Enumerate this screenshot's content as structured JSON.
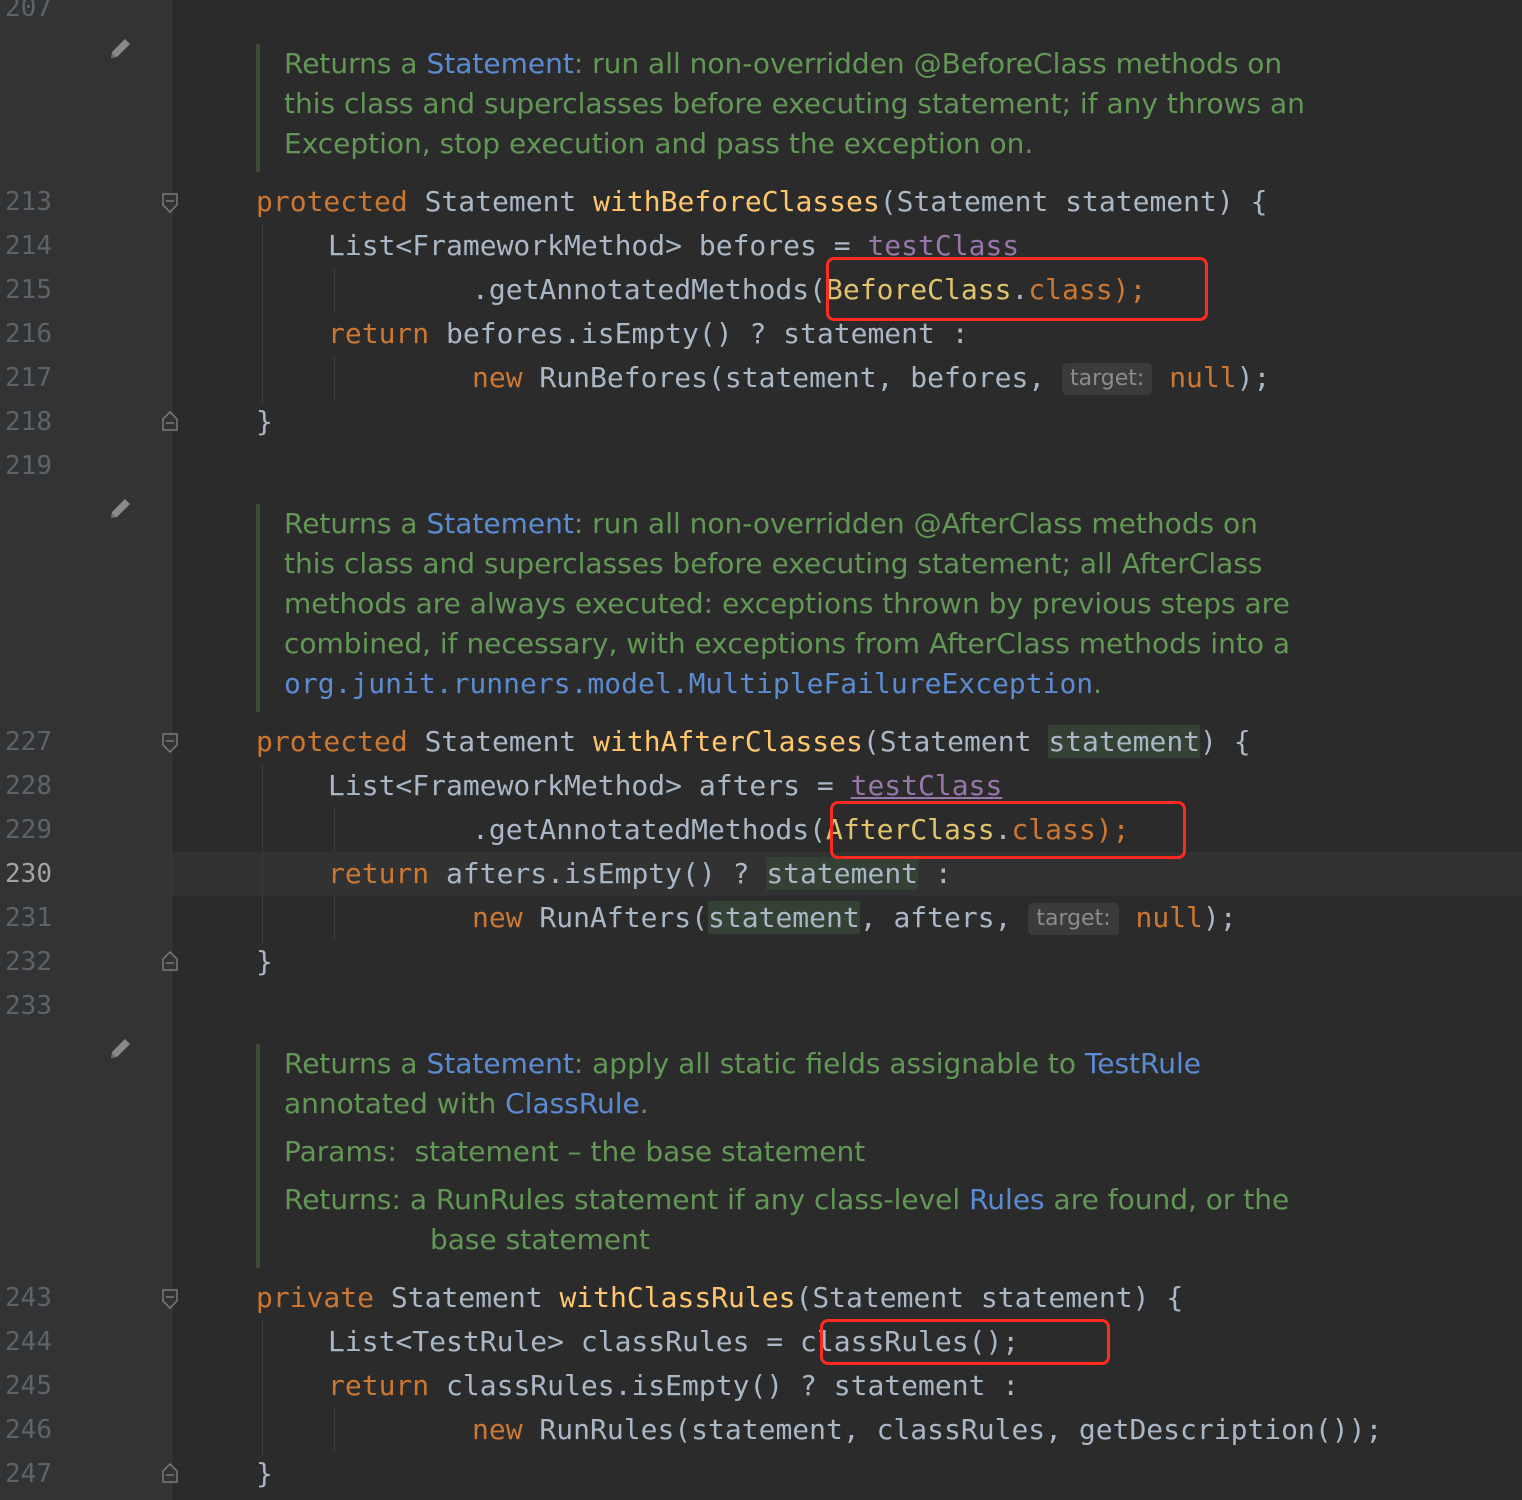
{
  "gutter": {
    "line_numbers": {
      "l207": "207",
      "l213": "213",
      "l214": "214",
      "l215": "215",
      "l216": "216",
      "l217": "217",
      "l218": "218",
      "l219": "219",
      "l227": "227",
      "l228": "228",
      "l229": "229",
      "l230": "230",
      "l231": "231",
      "l232": "232",
      "l233": "233",
      "l243": "243",
      "l244": "244",
      "l245": "245",
      "l246": "246",
      "l247": "247"
    },
    "current_line": "230"
  },
  "docs": {
    "before_classes": {
      "p1": "Returns a ",
      "link": "Statement",
      "p2": ": run all non-overridden @BeforeClass methods on",
      "line2": "this class and superclasses before executing statement; if any throws an",
      "line3": "Exception, stop execution and pass the exception on."
    },
    "after_classes": {
      "p1": "Returns a ",
      "link": "Statement",
      "p2": ": run all non-overridden @AfterClass methods on",
      "line2": "this class and superclasses before executing statement; all AfterClass",
      "line3": "methods are always executed: exceptions thrown by previous steps are",
      "line4": "combined, if necessary, with exceptions from AfterClass methods into a",
      "link2": "org.junit.runners.model.MultipleFailureException",
      "end": "."
    },
    "class_rules": {
      "p1": "Returns a ",
      "link": "Statement",
      "p2": ": apply all static fields assignable to ",
      "link_testrule": "TestRule",
      "p3": "annotated with ",
      "link_classrule": "ClassRule",
      "p4": ".",
      "params_label": "Params:",
      "params_text": "statement – the base statement",
      "returns_label": "Returns:",
      "returns_a": "a RunRules statement if any class-level ",
      "returns_link": "Rules",
      "returns_b": " are found, or the",
      "returns_c": "base statement"
    }
  },
  "code": {
    "l213": {
      "mod": "protected",
      "a": " Statement ",
      "name": "withBeforeClasses",
      "b": "(Statement statement) {"
    },
    "l214": {
      "a": "List<FrameworkMethod> befores = ",
      "field": "testClass"
    },
    "l215": {
      "a": ".getAnnotatedMethods(",
      "cls": "BeforeClass",
      "dot": ".",
      "kw": "class",
      "end": ");"
    },
    "l216": {
      "kw": "return",
      "a": " befores.isEmpty() ? statement :"
    },
    "l217": {
      "kw": "new",
      "a": " RunBefores(statement, befores, ",
      "hint": "target:",
      "null": "null",
      "end": ");"
    },
    "l218": {
      "a": "}"
    },
    "l227": {
      "mod": "protected",
      "a": " Statement ",
      "name": "withAfterClasses",
      "b": "(Statement ",
      "hl": "statement",
      "c": ") {"
    },
    "l228": {
      "a": "List<FrameworkMethod> afters = ",
      "field": "testClass"
    },
    "l229": {
      "a": ".getAnnotatedMethods(",
      "cls": "AfterClass",
      "dot": ".",
      "kw": "class",
      "end": ");"
    },
    "l230": {
      "kw": "return",
      "a": " afters.isEmpty() ? ",
      "hl": "statement",
      "b": " :"
    },
    "l231": {
      "kw": "new",
      "a": " RunAfters(",
      "hl": "statement",
      "b": ", afters, ",
      "hint": "target:",
      "null": "null",
      "end": ");"
    },
    "l232": {
      "a": "}"
    },
    "l243": {
      "mod": "private",
      "a": " Statement ",
      "name": "withClassRules",
      "b": "(Statement statement) {"
    },
    "l244": {
      "a": "List<TestRule> classRules = ",
      "b": "classRules();"
    },
    "l245": {
      "kw": "return",
      "a": " classRules.isEmpty() ? statement :"
    },
    "l246": {
      "kw": "new",
      "a": " RunRules(statement, classRules, getDescription());"
    },
    "l247": {
      "a": "}"
    }
  },
  "colors": {
    "background": "#2b2b2b",
    "keyword": "#cc7832",
    "method": "#ffc66d",
    "field": "#9876aa",
    "doc_comment": "#629755",
    "doc_link": "#5b8bd1",
    "highlight_box": "#ff2a20"
  },
  "icons": {
    "pencil": "edit-doc-pencil-icon",
    "fold_open": "fold-open-icon",
    "fold_close": "fold-close-icon"
  }
}
